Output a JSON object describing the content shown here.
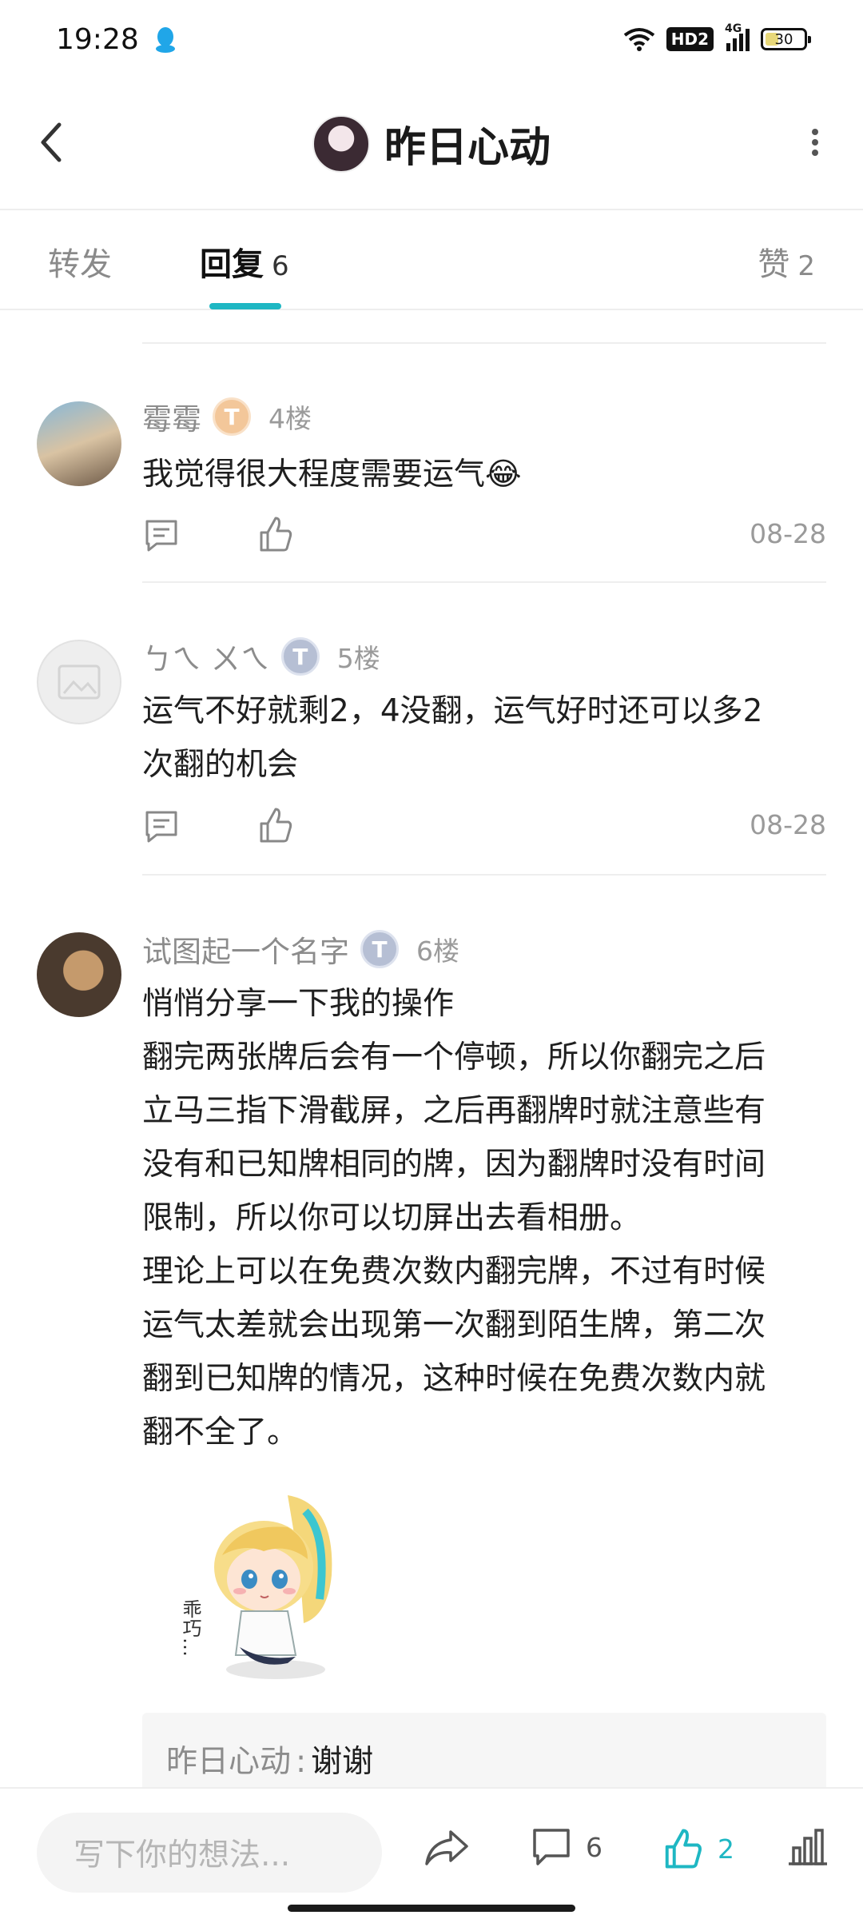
{
  "status_bar": {
    "time": "19:28",
    "hd_label": "HD2",
    "signal_label": "4G",
    "battery": "30"
  },
  "header": {
    "title": "昨日心动"
  },
  "tabs": {
    "forward": "转发",
    "reply": "回复",
    "reply_count": "6",
    "like": "赞",
    "like_count": "2"
  },
  "comments": [
    {
      "name": "霉霉",
      "level": "T",
      "floor": "4楼",
      "text": "我觉得很大程度需要运气😂",
      "date": "08-28"
    },
    {
      "name": "ㄅㄟ ㄨㄟ",
      "level": "T",
      "floor": "5楼",
      "text_lines": [
        "运气不好就剩2，4没翻，运气好时还可以多2",
        "次翻的机会"
      ],
      "date": "08-28"
    },
    {
      "name": "试图起一个名字",
      "level": "T",
      "floor": "6楼",
      "text_lines": [
        "悄悄分享一下我的操作",
        "翻完两张牌后会有一个停顿，所以你翻完之后",
        "立马三指下滑截屏，之后再翻牌时就注意些有",
        "没有和已知牌相同的牌，因为翻牌时没有时间",
        "限制，所以你可以切屏出去看相册。",
        "理论上可以在免费次数内翻完牌，不过有时候",
        "运气太差就会出现第一次翻到陌生牌，第二次",
        "翻到已知牌的情况，这种时候在免费次数内就",
        "翻不全了。"
      ],
      "sticker_text": "乖巧…",
      "quote": {
        "name": "昨日心动",
        "separator": ":",
        "text": "谢谢"
      }
    }
  ],
  "bottom_bar": {
    "input_placeholder": "写下你的想法...",
    "comment_count": "6",
    "like_count": "2"
  },
  "colors": {
    "accent": "#1eb7c3",
    "muted_text": "#8c8c8c",
    "divider": "#eeeeee"
  }
}
